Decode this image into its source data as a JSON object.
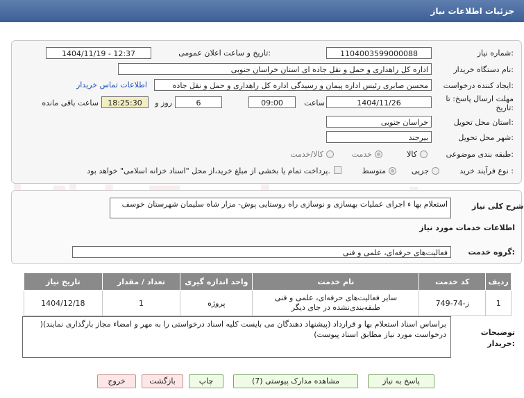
{
  "window": {
    "title": "جزئیات اطلاعات نیاز"
  },
  "watermark": "AriaTender.net",
  "form": {
    "need_number_label": "شماره نیاز:",
    "need_number": "1104003599000088",
    "announce_label": "تاریخ و ساعت اعلان عمومی:",
    "announce_value": "1404/11/19 - 12:37",
    "buyer_org_label": "نام دستگاه خریدار:",
    "buyer_org": "اداره کل راهداری و حمل و نقل جاده ای استان خراسان جنوبی",
    "creator_label": "ایجاد کننده درخواست:",
    "creator": "محسن صابری رئیس اداره پیمان و رسیدگی اداره کل راهداری و حمل و نقل جاده",
    "contact_link": "اطلاعات تماس خریدار",
    "deadline_label_1": "مهلت ارسال پاسخ: تا",
    "deadline_label_2": "تاریخ:",
    "deadline_date": "1404/11/26",
    "time_label": "ساعت",
    "deadline_time": "09:00",
    "days_value": "6",
    "days_label": "روز و",
    "remaining_time": "18:25:30",
    "remaining_label": "ساعت باقی مانده",
    "province_label": "استان محل تحویل:",
    "province": "خراسان جنوبی",
    "city_label": "شهر محل تحویل:",
    "city": "بیرجند",
    "category_label": "طبقه بندی موضوعی:",
    "category_options": [
      "کالا",
      "خدمت",
      "کالا/خدمت"
    ],
    "process_label": "نوع فرآیند خرید :",
    "process_options": [
      "جزیی",
      "متوسط"
    ],
    "payment_note": "پرداخت تمام یا بخشی از مبلغ خرید،از محل \"اسناد خزانه اسلامی\" خواهد بود."
  },
  "description": {
    "label": "شرح کلی نیاز:",
    "value": "استعلام بها ء اجرای عملیات  بهسازی و نوسازی راه روستایی پوش- مزار شاه سلیمان شهرستان خوسف"
  },
  "services": {
    "section_title": "اطلاعات خدمات مورد نیاز",
    "group_label": "گروه خدمت:",
    "group_value": "فعالیت‌های حرفه‌ای، علمی و فنی",
    "table": {
      "headers": [
        "ردیف",
        "کد خدمت",
        "نام خدمت",
        "واحد اندازه گیری",
        "تعداد / مقدار",
        "تاریخ نیاز"
      ],
      "rows": [
        [
          "1",
          "ز-74-749",
          "سایر فعالیت‌های حرفه‌ای، علمی و فنی طبقه‌بندی‌نشده در جای دیگر",
          "پروژه",
          "1",
          "1404/12/18"
        ]
      ]
    }
  },
  "buyer_notes": {
    "label_1": "توضیحات",
    "label_2": "خریدار:",
    "value": "براساس اسناد استعلام بها و قرارداد (پیشنهاد دهندگان می بایست کلیه اسناد درخواستی را به مهر و امضاء مجاز بارگذاری نمایند)( درخواست مورد نیاز مطابق اسناد پیوست)"
  },
  "buttons": {
    "reply": "پاسخ به نیاز",
    "attachments": "مشاهده مدارک پیوستی (7)",
    "print": "چاپ",
    "back": "بازگشت",
    "exit": "خروج"
  }
}
